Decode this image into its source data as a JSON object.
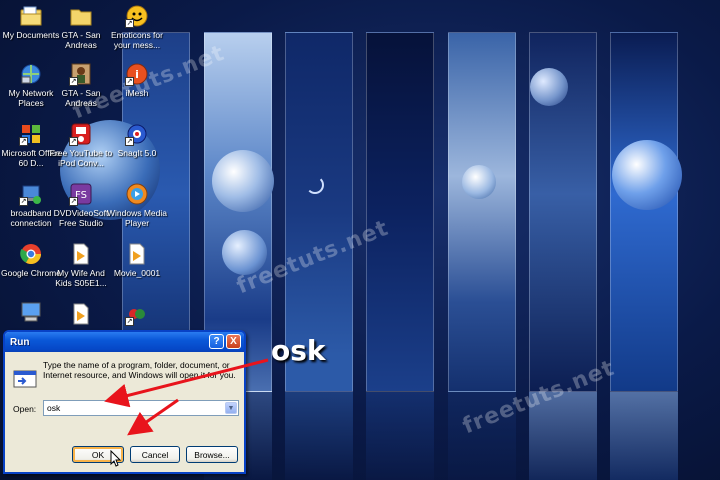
{
  "desktop": {
    "icons": [
      {
        "label": "My Documents",
        "icon": "folder-documents-icon"
      },
      {
        "label": "GTA - San Andreas",
        "icon": "folder-icon"
      },
      {
        "label": "Emoticons for your mess...",
        "icon": "smiley-icon"
      },
      {
        "label": "My Network Places",
        "icon": "network-icon"
      },
      {
        "label": "GTA - San Andreas",
        "icon": "game-icon"
      },
      {
        "label": "iMesh",
        "icon": "imesh-icon"
      },
      {
        "label": "Microsoft Office 60 D...",
        "icon": "office-icon"
      },
      {
        "label": "Free YouTube to iPod Conv...",
        "icon": "youtube-converter-icon"
      },
      {
        "label": "SnagIt 5.0",
        "icon": "snagit-icon"
      },
      {
        "label": "broadband connection",
        "icon": "broadband-icon"
      },
      {
        "label": "DVDVideoSoft Free Studio",
        "icon": "dvdvideosoft-icon"
      },
      {
        "label": "Windows Media Player",
        "icon": "media-player-icon"
      },
      {
        "label": "Google Chrome",
        "icon": "chrome-icon"
      },
      {
        "label": "My Wife And Kids S05E1...",
        "icon": "video-file-icon"
      },
      {
        "label": "Movie_0001",
        "icon": "video-file-icon"
      }
    ]
  },
  "run_dialog": {
    "title": "Run",
    "help_label": "?",
    "close_label": "X",
    "description": "Type the name of a program, folder, document, or Internet resource, and Windows will open it for you.",
    "open_label": "Open:",
    "open_value": "osk",
    "ok_label": "OK",
    "cancel_label": "Cancel",
    "browse_label": "Browse..."
  },
  "annotation": {
    "text": "osk",
    "arrow_color": "#e8141c"
  },
  "watermarks": [
    "freetuts.net",
    "freetuts.net",
    "freetuts.net"
  ]
}
